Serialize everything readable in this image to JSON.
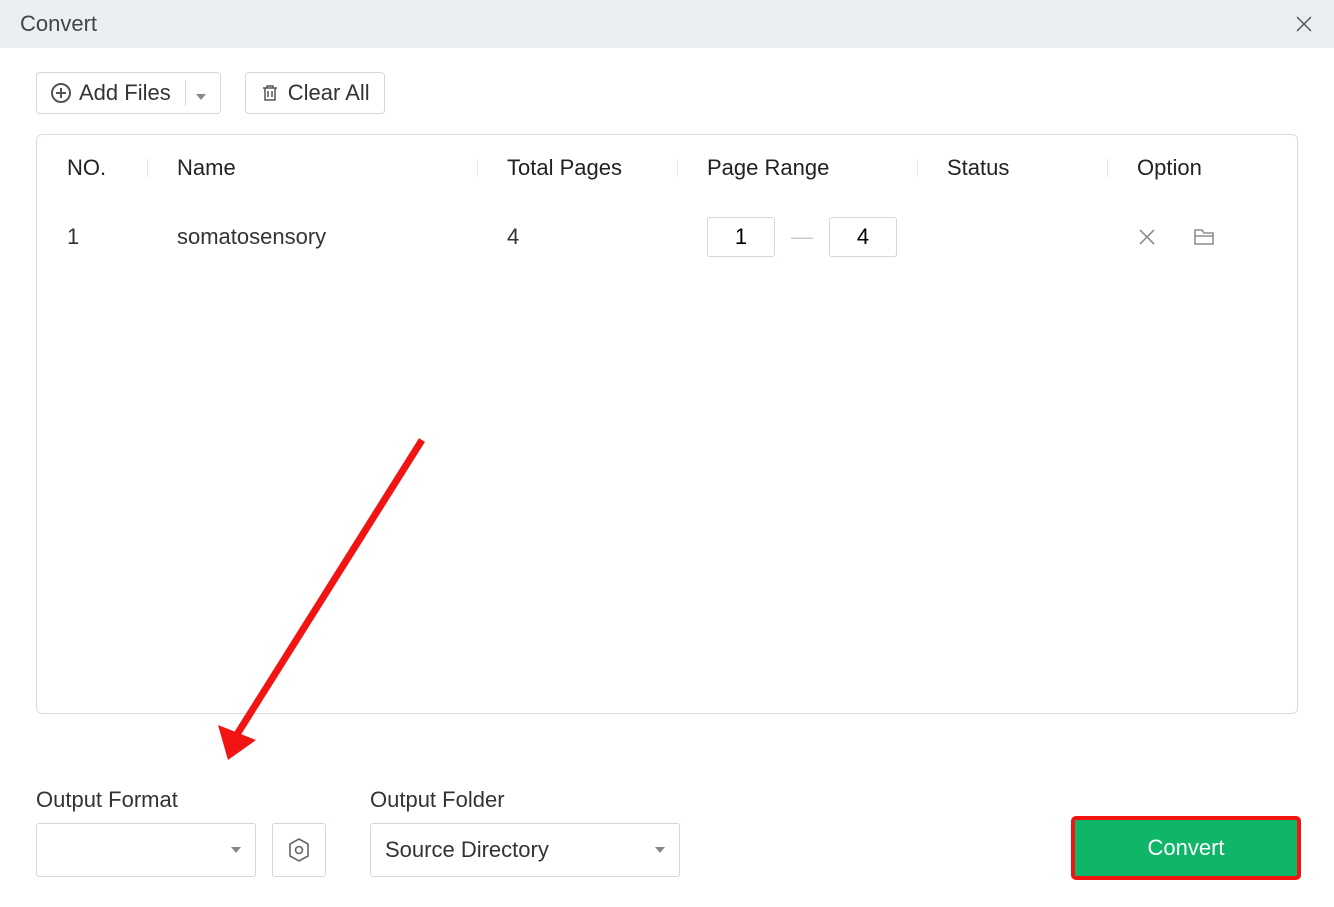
{
  "window": {
    "title": "Convert"
  },
  "toolbar": {
    "add_files_label": "Add Files",
    "clear_all_label": "Clear All"
  },
  "table": {
    "headers": {
      "no": "NO.",
      "name": "Name",
      "total_pages": "Total Pages",
      "page_range": "Page Range",
      "status": "Status",
      "option": "Option"
    },
    "rows": [
      {
        "no": "1",
        "name": "somatosensory",
        "total_pages": "4",
        "page_from": "1",
        "page_to": "4",
        "status": ""
      }
    ]
  },
  "footer": {
    "output_format_label": "Output Format",
    "output_format_value": "",
    "output_folder_label": "Output Folder",
    "output_folder_value": "Source Directory",
    "convert_label": "Convert"
  }
}
